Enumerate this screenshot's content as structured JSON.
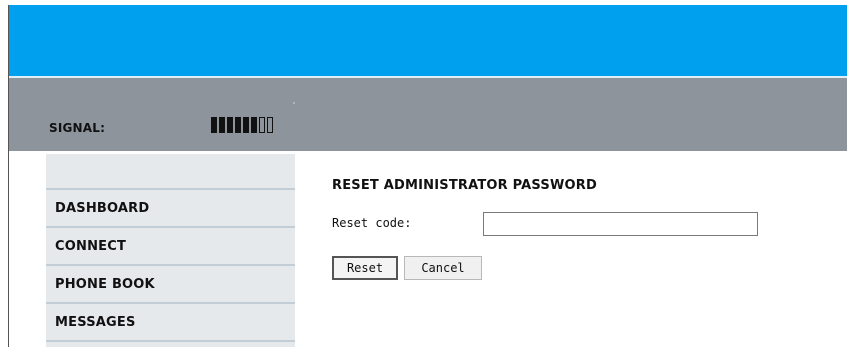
{
  "header": {
    "signal_label": "SIGNAL:",
    "signal_level": 6,
    "signal_max": 8
  },
  "sidebar": {
    "items": [
      {
        "label": "DASHBOARD"
      },
      {
        "label": "CONNECT"
      },
      {
        "label": "PHONE BOOK"
      },
      {
        "label": "MESSAGES"
      }
    ]
  },
  "main": {
    "title": "RESET ADMINISTRATOR PASSWORD",
    "reset_code_label": "Reset code:",
    "reset_code_value": "",
    "reset_button": "Reset",
    "cancel_button": "Cancel"
  },
  "colors": {
    "top_bar": "#00a0ef",
    "status_bar": "#8d949c",
    "sidebar_bg": "#e6e9ec"
  }
}
